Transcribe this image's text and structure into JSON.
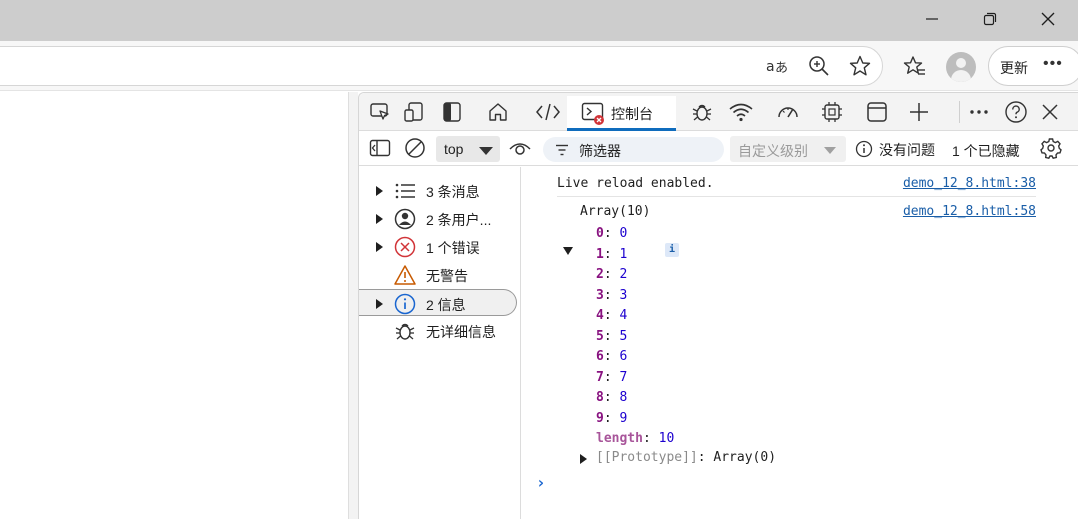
{
  "browser": {
    "toolbar": {
      "update_label": "更新",
      "more_label": "•••"
    }
  },
  "devtools": {
    "active_tab": "控制台",
    "filter_bar": {
      "context": "top",
      "filter_placeholder": "筛选器",
      "level": "自定义级别",
      "issues": "没有问题",
      "hidden": "1 个已隐藏"
    },
    "sidebar": {
      "items": [
        {
          "label": "3 条消息",
          "icon": "list-icon",
          "expandable": true
        },
        {
          "label": "2 条用户...",
          "icon": "user-icon",
          "expandable": true
        },
        {
          "label": "1 个错误",
          "icon": "error-icon",
          "expandable": true
        },
        {
          "label": "无警告",
          "icon": "warning-icon",
          "expandable": false
        },
        {
          "label": "2 信息",
          "icon": "info-icon",
          "expandable": true,
          "selected": true
        },
        {
          "label": "无详细信息",
          "icon": "bug-icon",
          "expandable": false
        }
      ]
    },
    "console": {
      "messages": [
        {
          "text": "Live reload enabled.",
          "source": "demo_12_8.html:38"
        },
        {
          "text": "Array(10)",
          "source": "demo_12_8.html:58",
          "badge": "i"
        }
      ],
      "array_entries": [
        {
          "key": "0",
          "value": "0"
        },
        {
          "key": "1",
          "value": "1"
        },
        {
          "key": "2",
          "value": "2"
        },
        {
          "key": "3",
          "value": "3"
        },
        {
          "key": "4",
          "value": "4"
        },
        {
          "key": "5",
          "value": "5"
        },
        {
          "key": "6",
          "value": "6"
        },
        {
          "key": "7",
          "value": "7"
        },
        {
          "key": "8",
          "value": "8"
        },
        {
          "key": "9",
          "value": "9"
        },
        {
          "key": "length",
          "value": "10"
        }
      ],
      "prototype": {
        "key": "[[Prototype]]",
        "value": "Array(0)"
      },
      "prompt": "›"
    }
  },
  "colors": {
    "accent": "#0f6cbd",
    "error": "#d13438",
    "warning": "#c75a00",
    "info": "#1a66d0",
    "link": "#1a5ea8",
    "key": "#881280",
    "number": "#1c00cf"
  }
}
